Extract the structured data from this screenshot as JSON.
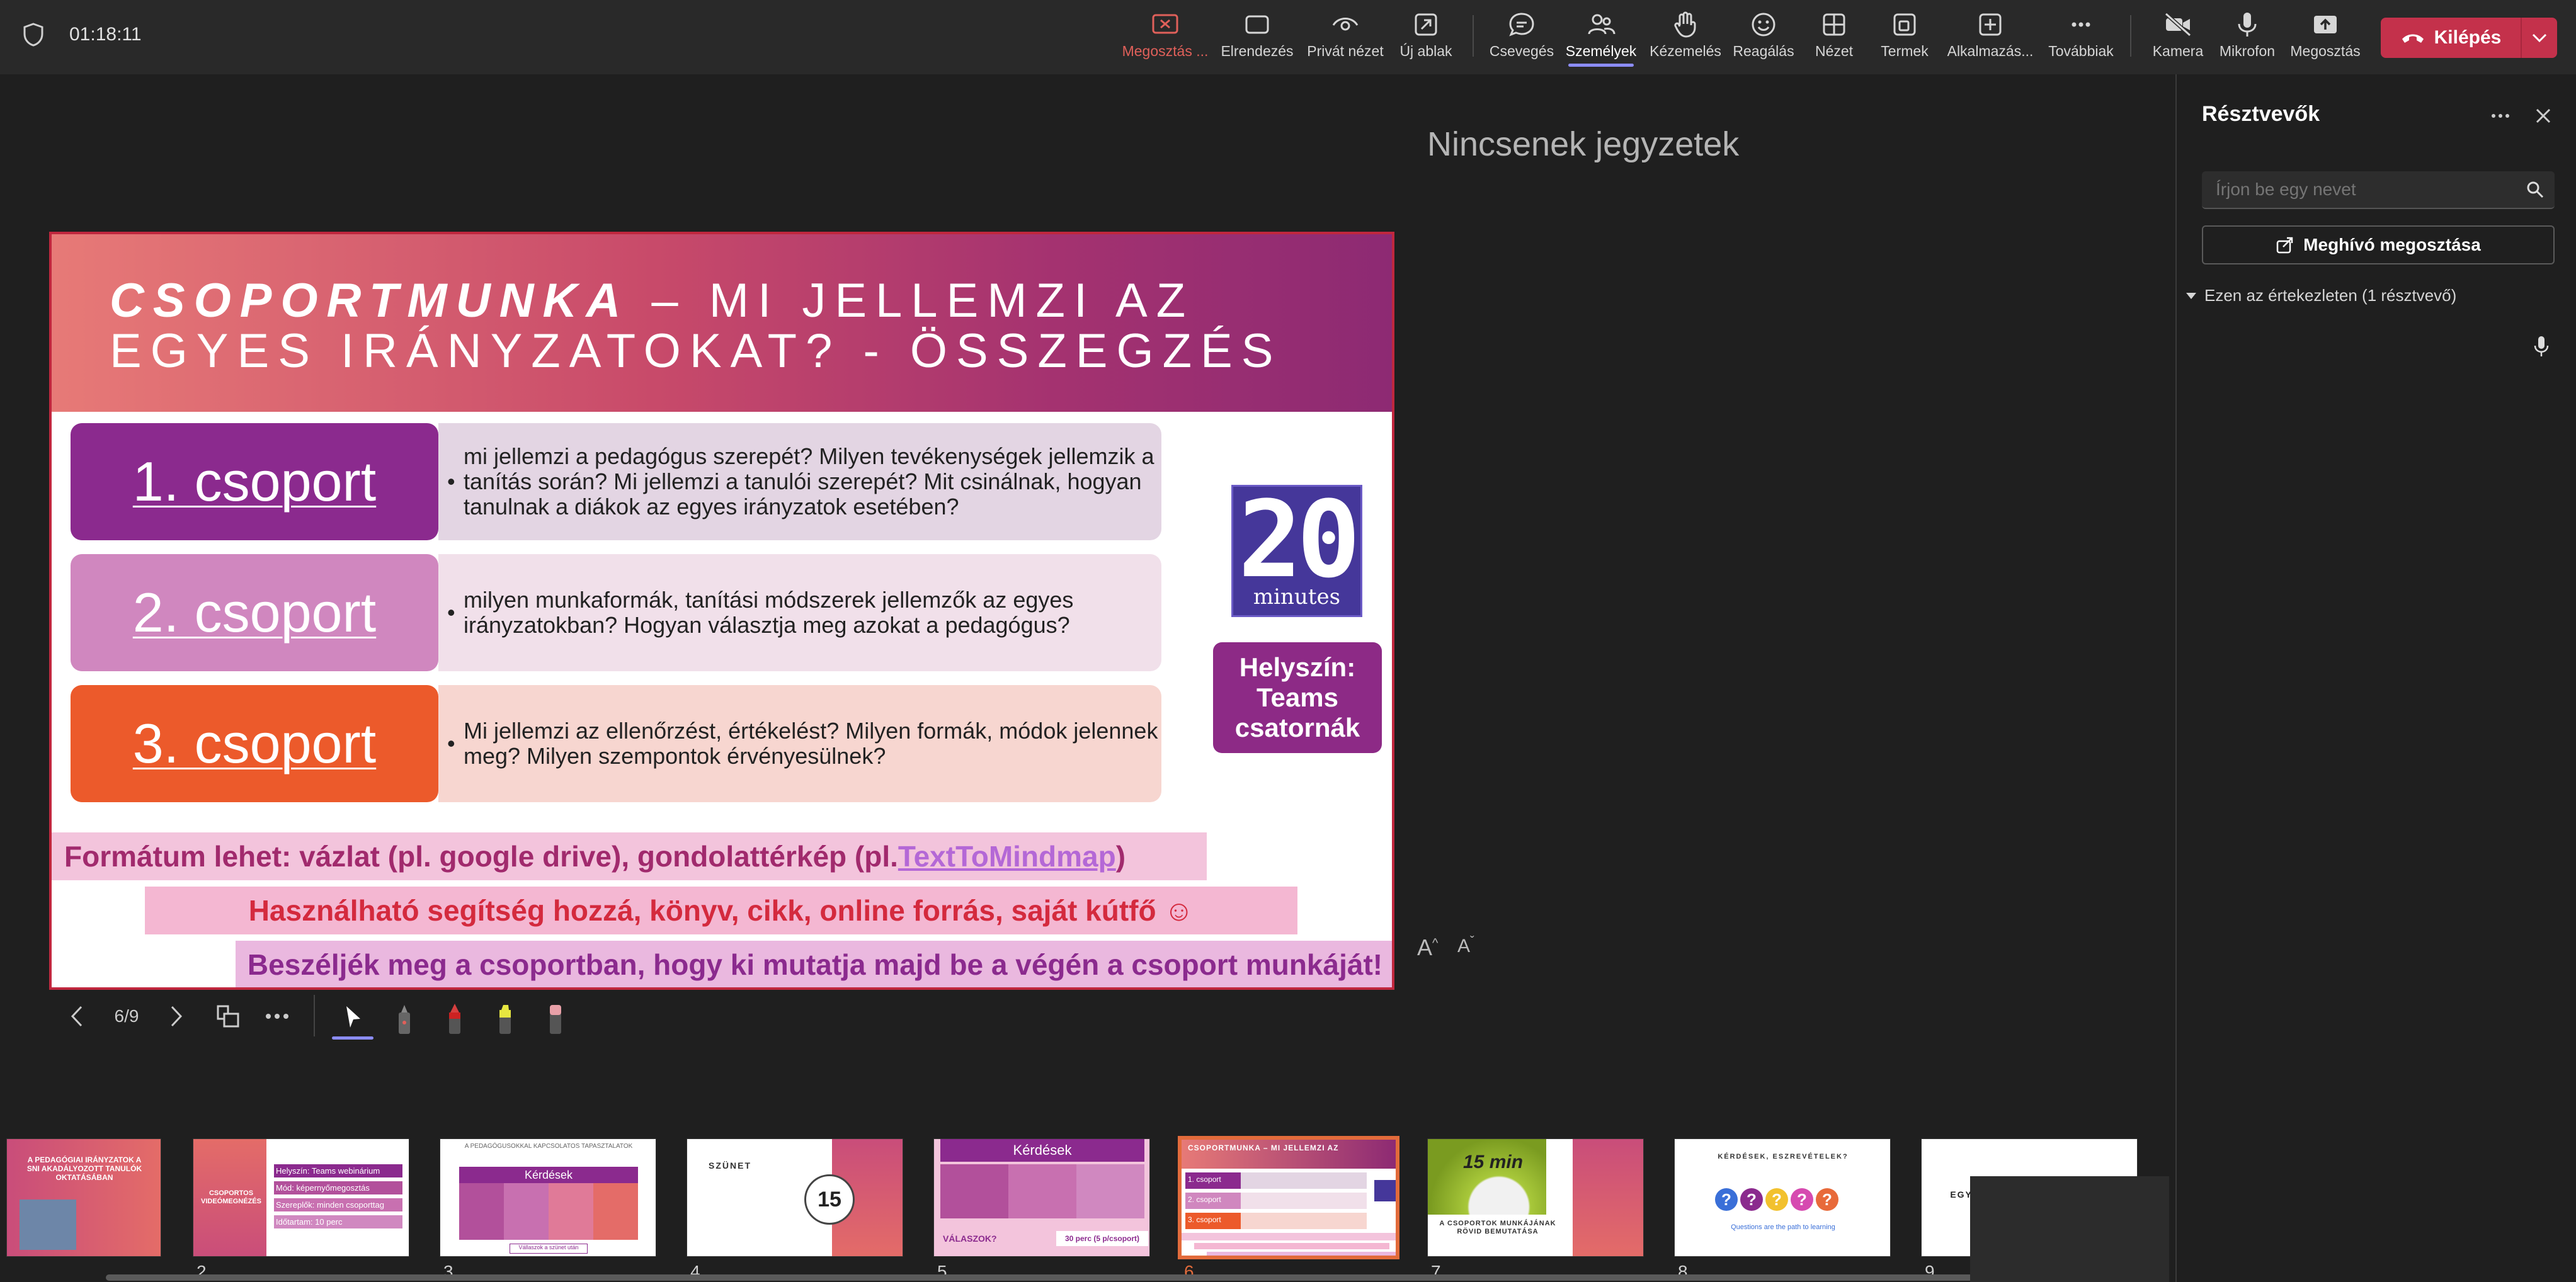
{
  "meeting": {
    "timer": "01:18:11"
  },
  "toolbar": {
    "items": [
      {
        "label": "Megosztás ...",
        "icon": "stop-share-icon"
      },
      {
        "label": "Elrendezés",
        "icon": "layout-icon"
      },
      {
        "label": "Privát nézet",
        "icon": "private-view-icon"
      },
      {
        "label": "Új ablak",
        "icon": "new-window-icon"
      },
      {
        "label": "Csevegés",
        "icon": "chat-icon"
      },
      {
        "label": "Személyek",
        "icon": "people-icon"
      },
      {
        "label": "Kézemelés",
        "icon": "raise-hand-icon"
      },
      {
        "label": "Reagálás",
        "icon": "react-icon"
      },
      {
        "label": "Nézet",
        "icon": "view-icon"
      },
      {
        "label": "Termek",
        "icon": "rooms-icon"
      },
      {
        "label": "Alkalmazás...",
        "icon": "apps-icon"
      },
      {
        "label": "Továbbiak",
        "icon": "more-icon"
      },
      {
        "label": "Kamera",
        "icon": "camera-off-icon"
      },
      {
        "label": "Mikrofon",
        "icon": "mic-icon"
      },
      {
        "label": "Megosztás",
        "icon": "share-icon"
      }
    ],
    "leave_label": "Kilépés",
    "accent_share": "#e0605a",
    "accent_active": "#8b8cf7",
    "leave_color": "#c4314b"
  },
  "slide": {
    "title_bold": "CSOPORTMUNKA",
    "title_rest_line1": " – MI JELLEMZI AZ",
    "title_line2": "EGYES IRÁNYZATOKAT? - ÖSSZEGZÉS",
    "groups": [
      {
        "label": "1. csoport",
        "text": "mi jellemzi a pedagógus szerepét? Milyen tevékenységek jellemzik a tanítás során? Mi jellemzi a tanulói szerepét? Mit csinálnak, hogyan tanulnak a diákok az egyes irányzatok esetében?",
        "color": "#8b2a8e",
        "bg": "#e3d5e3"
      },
      {
        "label": "2. csoport",
        "text": "milyen munkaformák, tanítási módszerek jellemzők az egyes irányzatokban? Hogyan választja meg azokat a pedagógus?",
        "color": "#d087bf",
        "bg": "#f1e0ea"
      },
      {
        "label": "3. csoport",
        "text": "Mi jellemzi az ellenőrzést, értékelést? Milyen formák, módok jelennek meg? Milyen szempontok érvényesülnek?",
        "color": "#ec5a2b",
        "bg": "#f7d6d0"
      }
    ],
    "badge_number": "20",
    "badge_unit": "minutes",
    "location_text": "Helyszín: Teams csatornák",
    "line1_prefix": "Formátum lehet: vázlat (pl. google drive), gondolattérkép (pl. ",
    "line1_link": "TextToMindmap",
    "line1_suffix": ")",
    "line2": "Használható segítség hozzá, könyv, cikk, online forrás, saját kútfő ☺",
    "line3": "Beszéljék meg a csoportban, hogy ki mutatja majd be a végén a csoport munkáját!"
  },
  "notes": {
    "empty_text": "Nincsenek jegyzetek",
    "font_increase": "A",
    "font_decrease": "A"
  },
  "controls": {
    "page_indicator": "6/9"
  },
  "thumbnails": [
    {
      "number": "",
      "lines": [
        "A PEDAGÓGIAI IRÁNYZATOK A",
        "SNI AKADÁLYOZOTT TANULÓK",
        "OKTATÁSÁBAN"
      ]
    },
    {
      "number": "2",
      "lines": [
        "CSOPORTOS",
        "VIDEÓMEGNÉZÉS"
      ],
      "items": [
        "Helyszín: Teams webinárium",
        "Mód: képernyőmegosztás",
        "Szereplők: minden csoporttag",
        "Időtartam: 10 perc"
      ]
    },
    {
      "number": "3",
      "lines": [
        "A PEDAGÓGUSOKKAL KAPCSOLATOS TAPASZTALATOK",
        "Kérdések",
        "Vállaszok a szünet után"
      ]
    },
    {
      "number": "4",
      "lines": [
        "SZÜNET",
        "15"
      ]
    },
    {
      "number": "5",
      "lines": [
        "Kérdések",
        "VÁLASZOK?",
        "30 perc (5 p/csoport)"
      ]
    },
    {
      "number": "6",
      "lines": [
        "CSOPORTMUNKA – MI JELLEMZI AZ",
        "1. csoport",
        "2. csoport",
        "3. csoport"
      ]
    },
    {
      "number": "7",
      "lines": [
        "15 min",
        "A CSOPORTOK MUNKÁJÁNAK RÖVID BEMUTATÁSA"
      ]
    },
    {
      "number": "8",
      "lines": [
        "KÉRDÉSEK, ESZREVÉTELEK?",
        "Questions are the path to learning"
      ]
    },
    {
      "number": "9",
      "lines": [
        "EGY HÉT MÚLVA FOLYTATJUK"
      ]
    }
  ],
  "participants": {
    "title": "Résztvevők",
    "search_placeholder": "Írjon be egy nevet",
    "invite_label": "Meghívó megosztása",
    "section_label": "Ezen az értekezleten (1 résztvevő)"
  }
}
